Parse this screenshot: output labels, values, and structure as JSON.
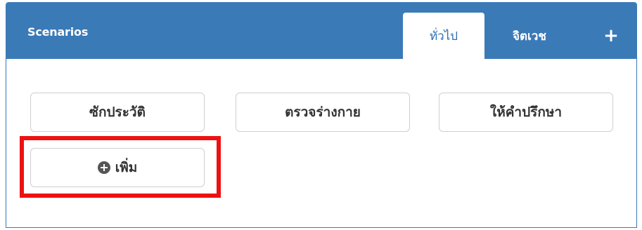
{
  "panel": {
    "title": "Scenarios",
    "tabs": [
      {
        "label": "ทั่วไป",
        "active": true
      },
      {
        "label": "จิตเวช",
        "active": false
      }
    ],
    "add_tab_label": "+"
  },
  "scenario_buttons": [
    {
      "label": "ซักประวัติ"
    },
    {
      "label": "ตรวจร่างกาย"
    },
    {
      "label": "ให้คำปรึกษา"
    }
  ],
  "add_button": {
    "label": "เพิ่ม",
    "icon": "plus-circle-icon"
  },
  "colors": {
    "header": "#3a7ab7",
    "active_tab_text": "#2f6fb0",
    "highlight": "#ee1111",
    "button_border": "#cfcfcf"
  }
}
